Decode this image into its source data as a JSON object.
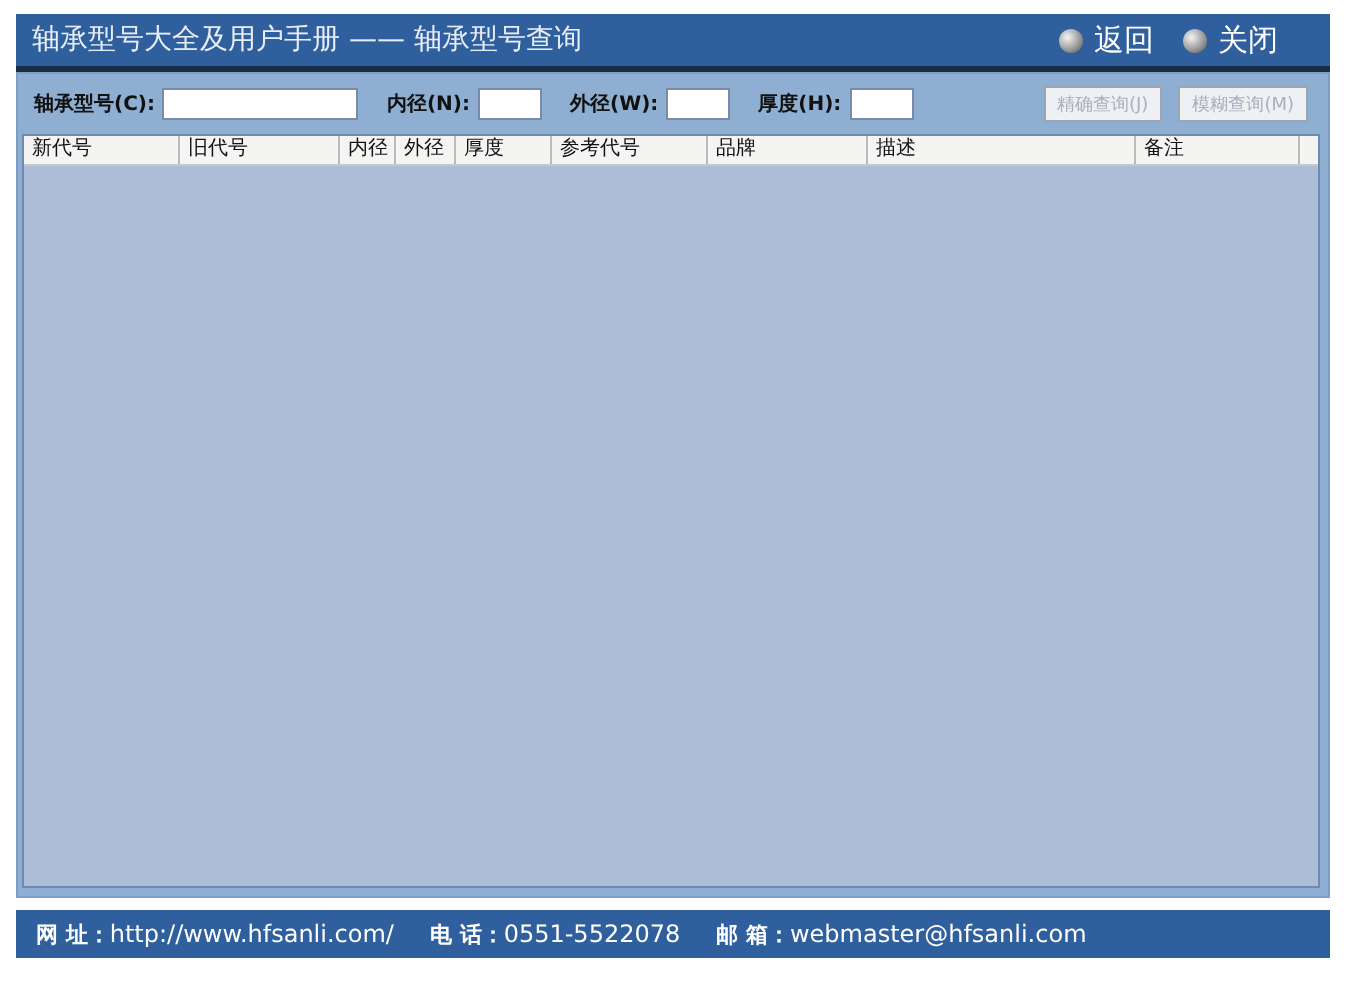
{
  "window": {
    "title": "轴承型号大全及用户手册 —— 轴承型号查询"
  },
  "header_buttons": [
    {
      "label": "返回"
    },
    {
      "label": "关闭"
    }
  ],
  "search": {
    "fields": [
      {
        "label": "轴承型号(C):"
      },
      {
        "label": "内径(N):"
      },
      {
        "label": "外径(W):"
      },
      {
        "label": "厚度(H):"
      }
    ],
    "buttons": [
      {
        "label": "精确查询(J)",
        "disabled": true
      },
      {
        "label": "模糊查询(M)",
        "disabled": true
      }
    ]
  },
  "table": {
    "columns": [
      {
        "label": "新代号"
      },
      {
        "label": "旧代号"
      },
      {
        "label": "内径"
      },
      {
        "label": "外径"
      },
      {
        "label": "厚度"
      },
      {
        "label": "参考代号"
      },
      {
        "label": "品牌"
      },
      {
        "label": "描述"
      },
      {
        "label": "备注"
      }
    ]
  },
  "status_bar": [
    {
      "label": "网 址：",
      "value": "http://www.hfsanli.com/"
    },
    {
      "label": "电 话：",
      "value": "0551-5522078"
    },
    {
      "label": "邮 箱：",
      "value": "webmaster@hfsanli.com"
    }
  ]
}
